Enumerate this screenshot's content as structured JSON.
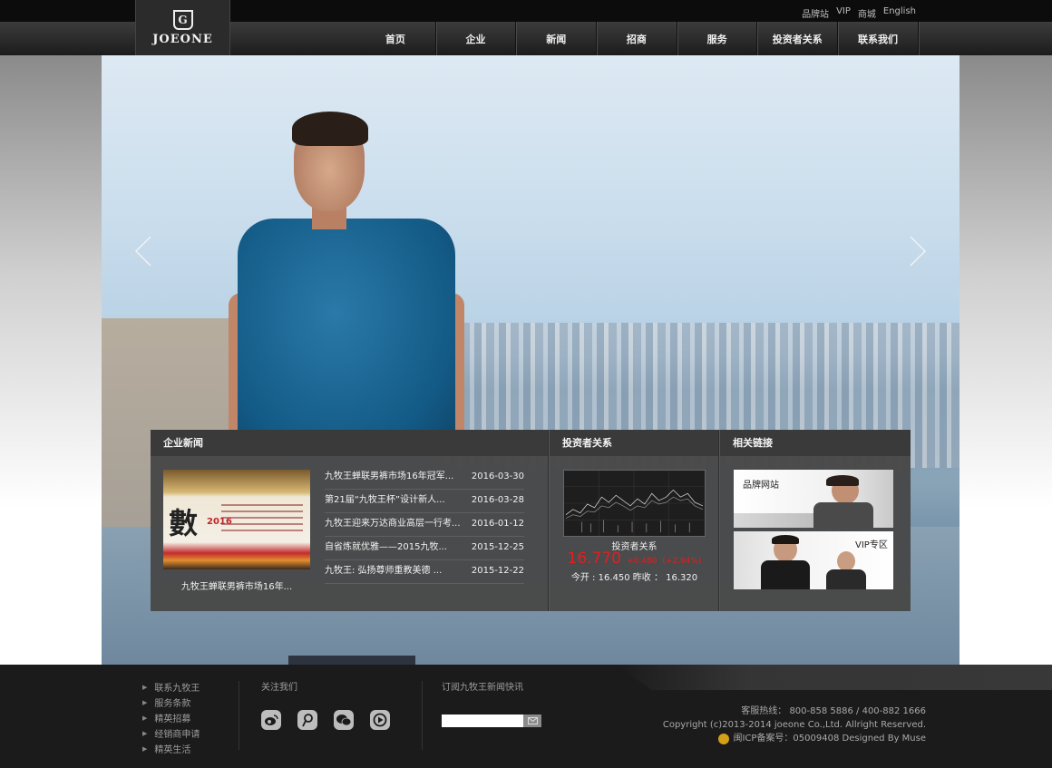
{
  "header": {
    "util_links": [
      "品牌站",
      "VIP",
      "商城",
      "English"
    ],
    "logo_text": "JOEONE",
    "logo_mark": "G",
    "nav": [
      "首页",
      "企业",
      "新闻",
      "招商",
      "服务",
      "投资者关系",
      "联系我们"
    ]
  },
  "panel": {
    "news": {
      "title": "企业新闻",
      "image_big_char": "數",
      "image_year": "2016",
      "image_caption": "九牧王蝉联男裤市场16年...",
      "items": [
        {
          "title": "九牧王蝉联男裤市场16年冠军...",
          "date": "2016-03-30"
        },
        {
          "title": "第21届“九牧王杯”设计新人...",
          "date": "2016-03-28"
        },
        {
          "title": "九牧王迎来万达商业高层一行考...",
          "date": "2016-01-12"
        },
        {
          "title": "自省炼就优雅——2015九牧...",
          "date": "2015-12-25"
        },
        {
          "title": "九牧王: 弘扬尊师重教美德 ...",
          "date": "2015-12-22"
        }
      ]
    },
    "investor": {
      "title": "投资者关系",
      "caption": "投资者关系",
      "price": "16.770",
      "change": "+0.480",
      "change_pct": "(+2.94%)",
      "open_close": "今开 : 16.450  昨收 ： 16.320"
    },
    "links": {
      "title": "相关链接",
      "brand_label": "品牌网站",
      "vip_label": "VIP专区"
    }
  },
  "footer": {
    "links": [
      "联系九牧王",
      "服务条款",
      "精英招募",
      "经销商申请",
      "精英生活"
    ],
    "follow_title": "关注我们",
    "social_icons": [
      "weibo-icon",
      "tencent-weibo-icon",
      "wechat-icon",
      "video-play-icon"
    ],
    "subscribe_title": "订阅九牧王新闻快讯",
    "subscribe_placeholder": "",
    "hotline": "客服热线： 800-858 5886 / 400-882 1666",
    "copyright": "Copyright (c)2013-2014 joeone Co.,Ltd. Allright Reserved.",
    "icp": "闽ICP备案号：05009408 Designed By Muse"
  },
  "colors": {
    "quote_red": "#e11f1f",
    "panel_bg": "#484848",
    "footer_bg": "#1b1b1b"
  }
}
